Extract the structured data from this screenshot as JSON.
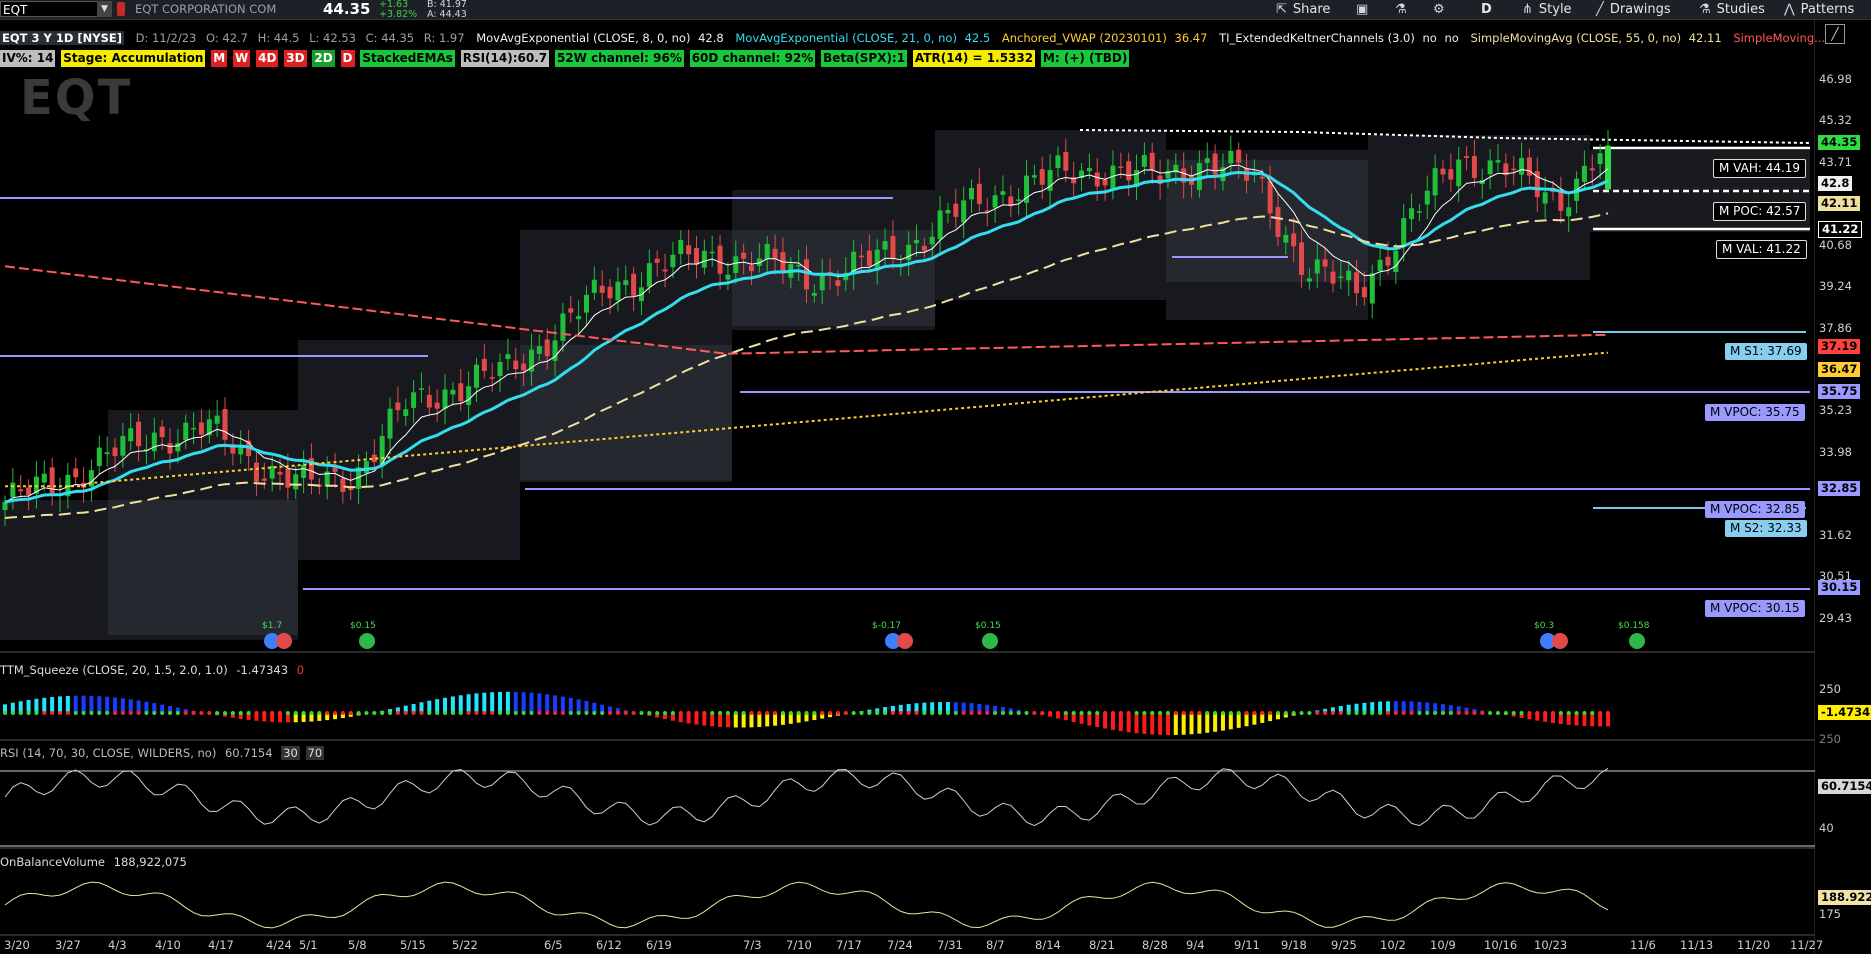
{
  "topbar": {
    "symbol": "EQT",
    "company": "EQT CORPORATION COM",
    "last_price": "44.35",
    "net_change": "+1.63",
    "pct_change": "+3.82%",
    "bid": "B: 41.97",
    "ask": "A: 44.43",
    "share_label": "Share",
    "period_label": "D",
    "style_label": "Style",
    "drawings_label": "Drawings",
    "studies_label": "Studies",
    "patterns_label": "Patterns"
  },
  "studybar": {
    "title": "EQT 3 Y 1D [NYSE]",
    "date": "D: 11/2/23",
    "open": "O: 42.7",
    "high": "H: 44.5",
    "low": "L: 42.53",
    "close": "C: 44.35",
    "range": "R: 1.97",
    "ema8_label": "MovAvgExponential (CLOSE, 8, 0, no)",
    "ema8_value": "42.8",
    "ema21_label": "MovAvgExponential (CLOSE, 21, 0, no)",
    "ema21_value": "42.5",
    "vwap_label": "Anchored_VWAP (20230101)",
    "vwap_value": "36.47",
    "keltner_label": "TI_ExtendedKeltnerChannels (3.0)",
    "keltner_v1": "no",
    "keltner_v2": "no",
    "sma_label": "SimpleMovingAvg (CLOSE, 55, 0, no)",
    "sma_value": "42.11",
    "sma2_label": "SimpleMoving..."
  },
  "chips": {
    "iv": "IV%: 14",
    "stage": "Stage: Accumulation",
    "m": "M",
    "w": "W",
    "d4": "4D",
    "d3": "3D",
    "d2": "2D",
    "d": "D",
    "stacked": "StackedEMAs",
    "rsi": "RSI(14):60.7",
    "w52": "52W channel: 96%",
    "d60": "60D channel: 92%",
    "beta": "Beta(SPX):1",
    "atr": "ATR(14) = 1.5332",
    "mom": "M: (+) (TBD)"
  },
  "logo_text": "EQT",
  "price_axis": {
    "ticks": [
      "46.98",
      "45.32",
      "43.71",
      "40.68",
      "39.24",
      "37.86",
      "35.23",
      "33.98",
      "31.62",
      "30.51",
      "29.43"
    ],
    "badges": {
      "last": "44.35",
      "ema8": "42.8",
      "sma": "42.11",
      "val": "41.22",
      "ema_long": "37.19",
      "vwap": "36.47",
      "vpoc1": "35.75",
      "vpoc2": "32.85",
      "vpoc3": "30.15"
    }
  },
  "levels": {
    "vah": "M VAH: 44.19",
    "poc": "M POC: 42.57",
    "val": "M VAL: 41.22",
    "s1": "M S1: 37.69",
    "vpoc1": "M VPOC: 35.75",
    "vpoc2": "M VPOC: 32.85",
    "s2": "M S2: 32.33",
    "vpoc3": "M VPOC: 30.15"
  },
  "dividends": [
    "$1.7",
    "$0.15",
    "$-0.17",
    "$0.15",
    "$0.3",
    "$0.158"
  ],
  "squeeze": {
    "label": "TTM_Squeeze (CLOSE, 20, 1.5, 2.0, 1.0)",
    "value": "-1.47343",
    "flag": "0",
    "axis_top": "250",
    "axis_bottom": "250",
    "badge": "-1.4734"
  },
  "rsi_pane": {
    "label": "RSI (14, 70, 30, CLOSE, WILDERS, no)",
    "value": "60.7154",
    "lower": "30",
    "upper": "70",
    "badge": "60.7154",
    "axis_mid": "40"
  },
  "obv_pane": {
    "label": "OnBalanceVolume",
    "value": "188,922,075",
    "badge": "188.922",
    "axis_bottom": "175"
  },
  "x_axis": [
    "3/20",
    "3/27",
    "4/3",
    "4/10",
    "4/17",
    "4/24",
    "5/1",
    "5/8",
    "5/15",
    "5/22",
    "6/5",
    "6/12",
    "6/19",
    "7/3",
    "7/10",
    "7/17",
    "7/24",
    "7/31",
    "8/7",
    "8/14",
    "8/21",
    "8/28",
    "9/4",
    "9/11",
    "9/18",
    "9/25",
    "10/2",
    "10/9",
    "10/16",
    "10/23",
    "11/6",
    "11/13",
    "11/20",
    "11/27"
  ],
  "colors": {
    "up_candle": "#1fbf3a",
    "down_candle": "#e24a4a",
    "ema8": "#ffffff",
    "ema21": "#33ddee",
    "sma55": "#f0e0a0",
    "vwap": "#ffcc33",
    "ema_long": "#ff5a5a",
    "vpoc": "#9999ff"
  },
  "chart_data": {
    "type": "candlestick",
    "x": [
      "3/20",
      "3/27",
      "4/3",
      "4/10",
      "4/17",
      "4/24",
      "5/1",
      "5/8",
      "5/15",
      "5/22",
      "5/29",
      "6/5",
      "6/12",
      "6/19",
      "6/26",
      "7/3",
      "7/10",
      "7/17",
      "7/24",
      "7/31",
      "8/7",
      "8/14",
      "8/21",
      "8/28",
      "9/4",
      "9/11",
      "9/18",
      "9/25",
      "10/2",
      "10/9",
      "10/16",
      "10/23",
      "10/30"
    ],
    "close": [
      30.9,
      31.6,
      32.6,
      33.4,
      33.7,
      32.4,
      31.5,
      32.0,
      34.5,
      35.3,
      35.8,
      37.4,
      38.9,
      39.8,
      40.2,
      40.0,
      39.4,
      39.7,
      40.6,
      41.8,
      42.7,
      43.2,
      43.5,
      43.1,
      43.8,
      43.0,
      39.6,
      38.9,
      41.4,
      43.9,
      43.4,
      42.3,
      44.35
    ],
    "last": {
      "date": "11/2/23",
      "open": 42.7,
      "high": 44.5,
      "low": 42.53,
      "close": 44.35
    },
    "ylim": [
      29.0,
      47.5
    ]
  }
}
